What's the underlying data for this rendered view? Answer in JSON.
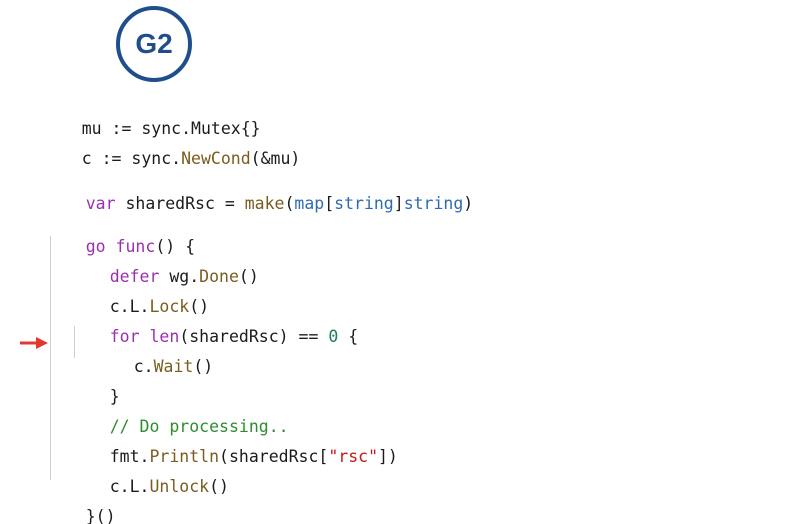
{
  "badge": {
    "label": "G2"
  },
  "code": {
    "l1": {
      "a": "mu := sync.Mutex{}"
    },
    "l2": {
      "a": "c := sync.",
      "b": "NewCond",
      "c": "(&mu)"
    },
    "l3": {
      "a": "var",
      "b": " sharedRsc = ",
      "c": "make",
      "d": "(",
      "e": "map",
      "f": "[",
      "g": "string",
      "h": "]",
      "i": "string",
      "j": ")"
    },
    "l4": {
      "a": "go",
      "b": " ",
      "c": "func",
      "d": "() {"
    },
    "l5": {
      "a": "defer",
      "b": " wg.",
      "c": "Done",
      "d": "()"
    },
    "l6": {
      "a": "c.L.",
      "b": "Lock",
      "c": "()"
    },
    "l7": {
      "a": "for",
      "b": " ",
      "c": "len",
      "d": "(sharedRsc) == ",
      "e": "0",
      "f": " {"
    },
    "l8": {
      "a": "c.",
      "b": "Wait",
      "c": "()"
    },
    "l9": {
      "a": "}"
    },
    "l10": {
      "a": "// Do processing.."
    },
    "l11": {
      "a": "fmt.",
      "b": "Println",
      "c": "(sharedRsc[",
      "d": "\"rsc\"",
      "e": "])"
    },
    "l12": {
      "a": "c.L.",
      "b": "Unlock",
      "c": "()"
    },
    "l13": {
      "a": "}()"
    }
  },
  "colors": {
    "keyword": "#9b2fae",
    "function": "#7a5c1e",
    "type": "#2f6bb0",
    "number": "#1c7d4f",
    "string": "#c41a16",
    "comment": "#2f8c2f",
    "badge": "#1f4e8c",
    "arrow": "#e03a2f"
  },
  "icons": {
    "pointer": "right-arrow-icon"
  }
}
